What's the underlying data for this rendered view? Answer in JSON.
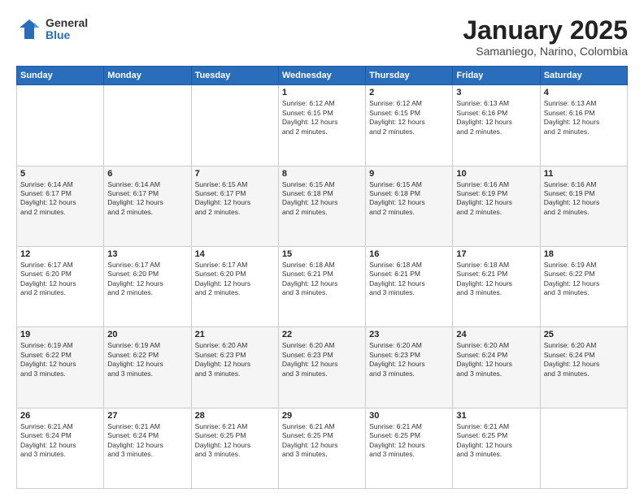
{
  "header": {
    "logo": {
      "general": "General",
      "blue": "Blue"
    },
    "title": "January 2025",
    "location": "Samaniego, Narino, Colombia"
  },
  "weekdays": [
    "Sunday",
    "Monday",
    "Tuesday",
    "Wednesday",
    "Thursday",
    "Friday",
    "Saturday"
  ],
  "weeks": [
    [
      {
        "day": "",
        "info": ""
      },
      {
        "day": "",
        "info": ""
      },
      {
        "day": "",
        "info": ""
      },
      {
        "day": "1",
        "info": "Sunrise: 6:12 AM\nSunset: 6:15 PM\nDaylight: 12 hours\nand 2 minutes."
      },
      {
        "day": "2",
        "info": "Sunrise: 6:12 AM\nSunset: 6:15 PM\nDaylight: 12 hours\nand 2 minutes."
      },
      {
        "day": "3",
        "info": "Sunrise: 6:13 AM\nSunset: 6:16 PM\nDaylight: 12 hours\nand 2 minutes."
      },
      {
        "day": "4",
        "info": "Sunrise: 6:13 AM\nSunset: 6:16 PM\nDaylight: 12 hours\nand 2 minutes."
      }
    ],
    [
      {
        "day": "5",
        "info": "Sunrise: 6:14 AM\nSunset: 6:17 PM\nDaylight: 12 hours\nand 2 minutes."
      },
      {
        "day": "6",
        "info": "Sunrise: 6:14 AM\nSunset: 6:17 PM\nDaylight: 12 hours\nand 2 minutes."
      },
      {
        "day": "7",
        "info": "Sunrise: 6:15 AM\nSunset: 6:17 PM\nDaylight: 12 hours\nand 2 minutes."
      },
      {
        "day": "8",
        "info": "Sunrise: 6:15 AM\nSunset: 6:18 PM\nDaylight: 12 hours\nand 2 minutes."
      },
      {
        "day": "9",
        "info": "Sunrise: 6:15 AM\nSunset: 6:18 PM\nDaylight: 12 hours\nand 2 minutes."
      },
      {
        "day": "10",
        "info": "Sunrise: 6:16 AM\nSunset: 6:19 PM\nDaylight: 12 hours\nand 2 minutes."
      },
      {
        "day": "11",
        "info": "Sunrise: 6:16 AM\nSunset: 6:19 PM\nDaylight: 12 hours\nand 2 minutes."
      }
    ],
    [
      {
        "day": "12",
        "info": "Sunrise: 6:17 AM\nSunset: 6:20 PM\nDaylight: 12 hours\nand 2 minutes."
      },
      {
        "day": "13",
        "info": "Sunrise: 6:17 AM\nSunset: 6:20 PM\nDaylight: 12 hours\nand 2 minutes."
      },
      {
        "day": "14",
        "info": "Sunrise: 6:17 AM\nSunset: 6:20 PM\nDaylight: 12 hours\nand 2 minutes."
      },
      {
        "day": "15",
        "info": "Sunrise: 6:18 AM\nSunset: 6:21 PM\nDaylight: 12 hours\nand 3 minutes."
      },
      {
        "day": "16",
        "info": "Sunrise: 6:18 AM\nSunset: 6:21 PM\nDaylight: 12 hours\nand 3 minutes."
      },
      {
        "day": "17",
        "info": "Sunrise: 6:18 AM\nSunset: 6:21 PM\nDaylight: 12 hours\nand 3 minutes."
      },
      {
        "day": "18",
        "info": "Sunrise: 6:19 AM\nSunset: 6:22 PM\nDaylight: 12 hours\nand 3 minutes."
      }
    ],
    [
      {
        "day": "19",
        "info": "Sunrise: 6:19 AM\nSunset: 6:22 PM\nDaylight: 12 hours\nand 3 minutes."
      },
      {
        "day": "20",
        "info": "Sunrise: 6:19 AM\nSunset: 6:22 PM\nDaylight: 12 hours\nand 3 minutes."
      },
      {
        "day": "21",
        "info": "Sunrise: 6:20 AM\nSunset: 6:23 PM\nDaylight: 12 hours\nand 3 minutes."
      },
      {
        "day": "22",
        "info": "Sunrise: 6:20 AM\nSunset: 6:23 PM\nDaylight: 12 hours\nand 3 minutes."
      },
      {
        "day": "23",
        "info": "Sunrise: 6:20 AM\nSunset: 6:23 PM\nDaylight: 12 hours\nand 3 minutes."
      },
      {
        "day": "24",
        "info": "Sunrise: 6:20 AM\nSunset: 6:24 PM\nDaylight: 12 hours\nand 3 minutes."
      },
      {
        "day": "25",
        "info": "Sunrise: 6:20 AM\nSunset: 6:24 PM\nDaylight: 12 hours\nand 3 minutes."
      }
    ],
    [
      {
        "day": "26",
        "info": "Sunrise: 6:21 AM\nSunset: 6:24 PM\nDaylight: 12 hours\nand 3 minutes."
      },
      {
        "day": "27",
        "info": "Sunrise: 6:21 AM\nSunset: 6:24 PM\nDaylight: 12 hours\nand 3 minutes."
      },
      {
        "day": "28",
        "info": "Sunrise: 6:21 AM\nSunset: 6:25 PM\nDaylight: 12 hours\nand 3 minutes."
      },
      {
        "day": "29",
        "info": "Sunrise: 6:21 AM\nSunset: 6:25 PM\nDaylight: 12 hours\nand 3 minutes."
      },
      {
        "day": "30",
        "info": "Sunrise: 6:21 AM\nSunset: 6:25 PM\nDaylight: 12 hours\nand 3 minutes."
      },
      {
        "day": "31",
        "info": "Sunrise: 6:21 AM\nSunset: 6:25 PM\nDaylight: 12 hours\nand 3 minutes."
      },
      {
        "day": "",
        "info": ""
      }
    ]
  ]
}
